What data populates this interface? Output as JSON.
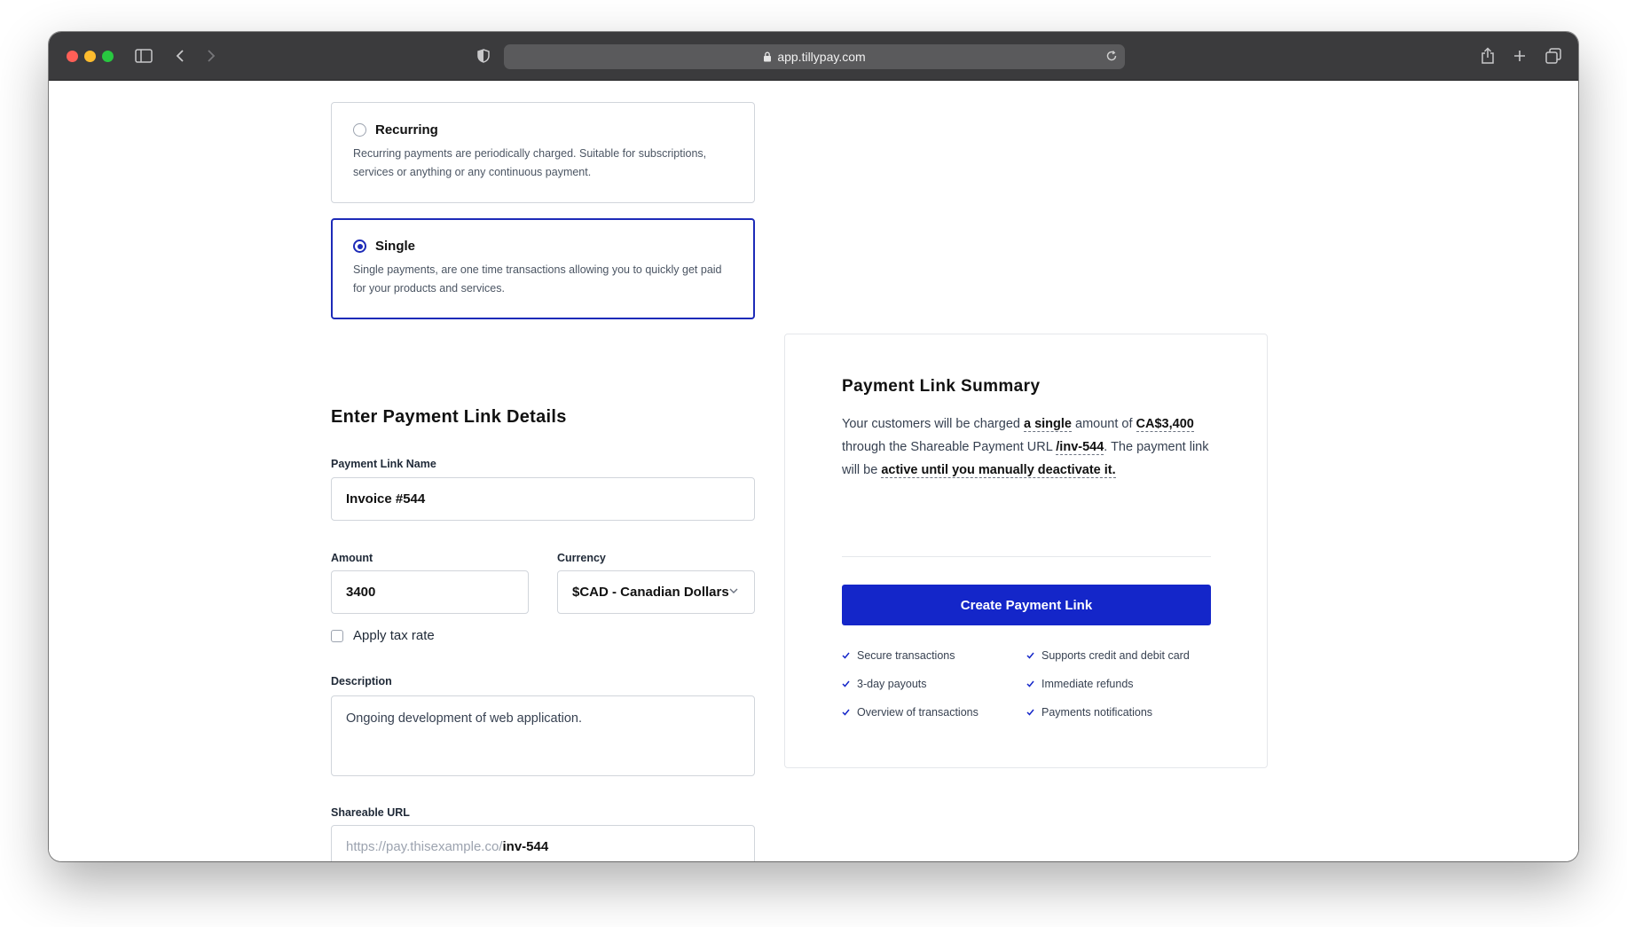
{
  "browser": {
    "url": "app.tillypay.com"
  },
  "payment_type": {
    "options": [
      {
        "title": "Recurring",
        "description": "Recurring payments are periodically charged. Suitable for subscriptions, services or anything or any continuous payment.",
        "selected": false
      },
      {
        "title": "Single",
        "description": "Single payments, are one time transactions allowing you to quickly get paid for your products and services.",
        "selected": true
      }
    ]
  },
  "form": {
    "section_title": "Enter Payment Link Details",
    "name_label": "Payment Link Name",
    "name_value": "Invoice #544",
    "amount_label": "Amount",
    "amount_value": "3400",
    "currency_label": "Currency",
    "currency_value": "$CAD - Canadian Dollars",
    "tax_label": "Apply tax rate",
    "tax_checked": false,
    "description_label": "Description",
    "description_value": "Ongoing development of web application.",
    "url_label": "Shareable URL",
    "url_prefix": "https://pay.thisexample.co/",
    "url_slug": "inv-544"
  },
  "summary": {
    "title": "Payment Link Summary",
    "text_1": "Your customers will be charged ",
    "frequency": "a single",
    "text_2": " amount of ",
    "amount": "CA$3,400",
    "text_3": " through the Shareable Payment URL ",
    "url": "/inv-544",
    "text_4": ". The payment link will be ",
    "expiry": "active until you manually deactivate it.",
    "cta_label": "Create Payment Link",
    "features": [
      "Secure transactions",
      "Supports credit and debit card",
      "3-day payouts",
      "Immediate refunds",
      "Overview of transactions",
      "Payments notifications"
    ]
  },
  "colors": {
    "accent": "#1426c9",
    "selected_border": "#1d2bb8",
    "toolbar": "#3b3b3d"
  }
}
